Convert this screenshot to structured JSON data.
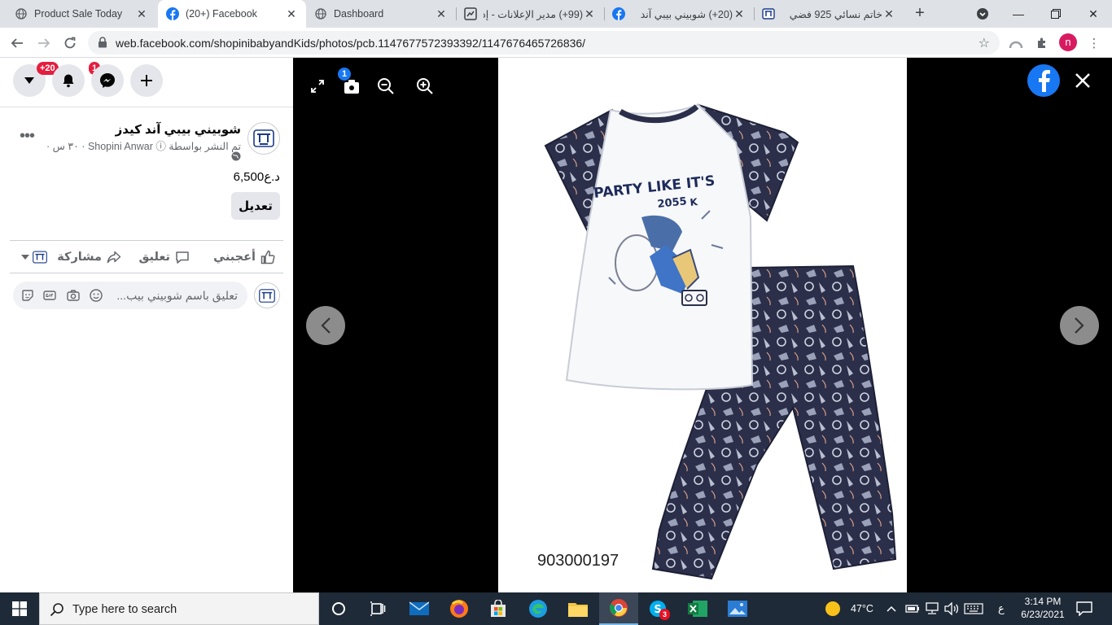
{
  "browser": {
    "tabs": [
      {
        "title": "Product Sale Today",
        "icon": "globe-icon",
        "active": false
      },
      {
        "title": "(20+) Facebook",
        "icon": "facebook-icon",
        "active": true
      },
      {
        "title": "Dashboard",
        "icon": "globe-icon",
        "active": false
      },
      {
        "title": "(99+) مدير الإعلانات - إد",
        "icon": "ads-manager-icon",
        "active": false
      },
      {
        "title": "(20+) شوبيني بيبي آند",
        "icon": "facebook-icon",
        "active": false
      },
      {
        "title": "خاتم نسائي 925 فضي",
        "icon": "shopini-icon",
        "active": false
      }
    ],
    "url": "web.facebook.com/shopinibabyandKids/photos/pcb.1147677572393392/1147676465726836/",
    "profile_initial": "n"
  },
  "fb_nav": {
    "notifications_badge": "+20",
    "messenger_badge": "1"
  },
  "post": {
    "page_name": "شوبيني بيبي آند كيدز",
    "meta": "تم النشر بواسطة Shopini Anwar ⓘ · ٣٠ س ·",
    "price": "6,500د.ع",
    "edit_label": "تعديل",
    "actions": {
      "like": "أعجبني",
      "comment": "تعليق",
      "share": "مشاركة"
    },
    "comment_placeholder": "تعليق باسم شوبيني بيب..."
  },
  "viewer": {
    "tag_count": "1",
    "photo_label": "903000197",
    "shirt_text": "PARTY LIKE IT'S",
    "shirt_year": "2055",
    "shirt_suffix": "K"
  },
  "taskbar": {
    "search_placeholder": "Type here to search",
    "skype_badge": "3",
    "weather": "47°C",
    "language": "ع",
    "time": "3:14 PM",
    "date": "6/23/2021"
  }
}
